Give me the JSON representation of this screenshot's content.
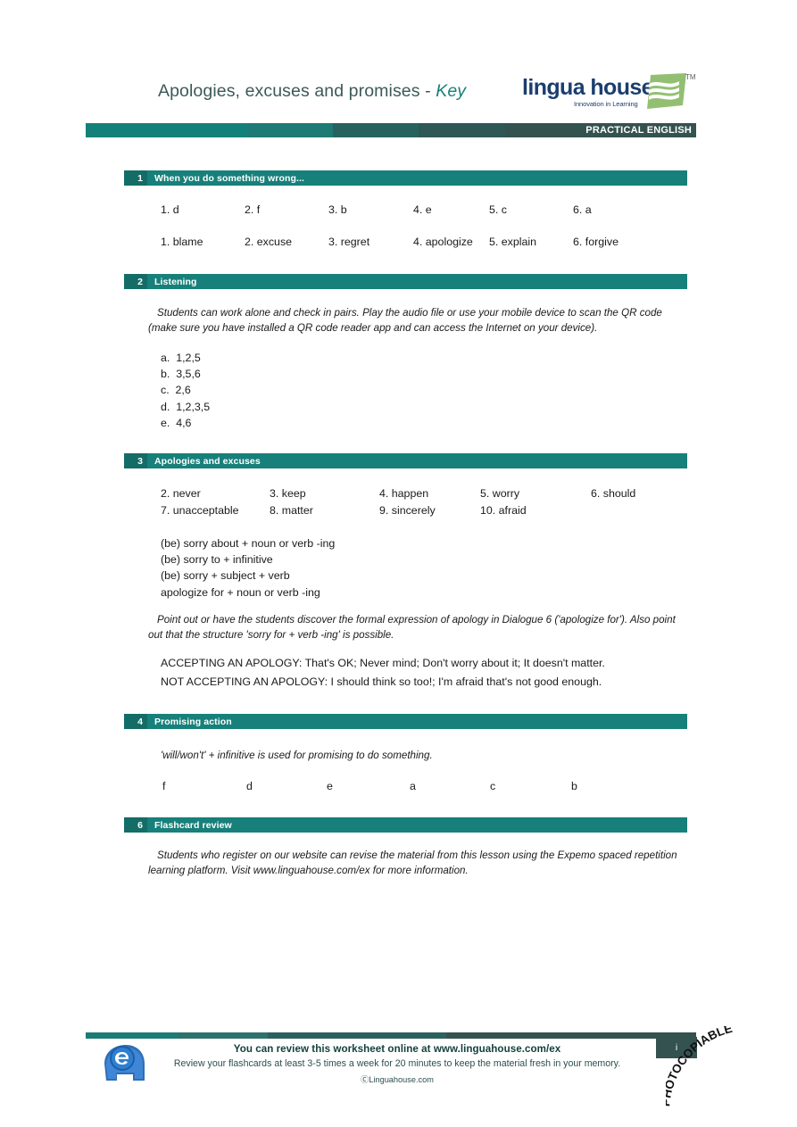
{
  "header": {
    "title_main": "Apologies, excuses and promises - ",
    "title_key": "Key",
    "logo_word": "lingua house",
    "logo_tagline": "Innovation in Learning",
    "logo_tm": "TM",
    "banner_label": "PRACTICAL ENGLISH"
  },
  "sections": [
    {
      "number": "1",
      "title": "When you do something wrong...",
      "answers_row1": [
        "1. d",
        "2. f",
        "3. b",
        "4. e",
        "5. c",
        "6. a"
      ],
      "answers_row2": [
        "1. blame",
        "2. excuse",
        "3. regret",
        "4. apologize",
        "5. explain",
        "6. forgive"
      ]
    },
    {
      "number": "2",
      "title": "Listening",
      "note": "Students can work alone and check in pairs. Play the audio file or use your mobile device to scan the QR code (make sure you have installed a QR code reader app and can access the Internet on your device).",
      "list": [
        "a.  1,2,5",
        "b.  3,5,6",
        "c.  2,6",
        "d.  1,2,3,5",
        "e.  4,6"
      ]
    },
    {
      "number": "3",
      "title": "Apologies and excuses",
      "answers_row1": [
        "2. never",
        "3. keep",
        "4. happen",
        "5. worry",
        "6. should"
      ],
      "answers_row2": [
        "7. unacceptable",
        "8. matter",
        "9. sincerely",
        "10. afraid"
      ],
      "structures": "(be) sorry about + noun or verb -ing\n(be) sorry to + infinitive\n(be) sorry + subject + verb\napologize for + noun or verb -ing",
      "note": "Point out or have the students discover the formal expression of apology in Dialogue 6 ('apologize for'). Also point out that the structure 'sorry for + verb -ing' is possible.",
      "accepting": "ACCEPTING AN APOLOGY: That's OK; Never mind; Don't worry about it; It doesn't matter.",
      "not_accepting": "NOT ACCEPTING AN APOLOGY: I should think so too!; I'm afraid that's not good enough."
    },
    {
      "number": "4",
      "title": "Promising action",
      "note": "'will/won't' + infinitive is used for promising to do something.",
      "answers_row1": [
        "f",
        "d",
        "e",
        "a",
        "c",
        "b"
      ]
    },
    {
      "number": "6",
      "title": "Flashcard review",
      "note": "Students who register on our website can revise the material from this lesson using the Expemo spaced repetition learning platform. Visit www.linguahouse.com/ex for more information."
    }
  ],
  "footer": {
    "line1": "You can review this worksheet online at www.linguahouse.com/ex",
    "line2": "Review your flashcards at least 3-5 times a week for 20 minutes to keep the material fresh in your memory.",
    "line3": "ⒸLinguahouse.com",
    "page_number": "i",
    "photocopiable": "PHOTOCOPIABLE"
  },
  "colors": {
    "teal": "#17807a",
    "teal_dark": "#34524f",
    "title": "#3c5a58",
    "logo_navy": "#1b3e6f",
    "logo_green": "#8fbc6f"
  }
}
